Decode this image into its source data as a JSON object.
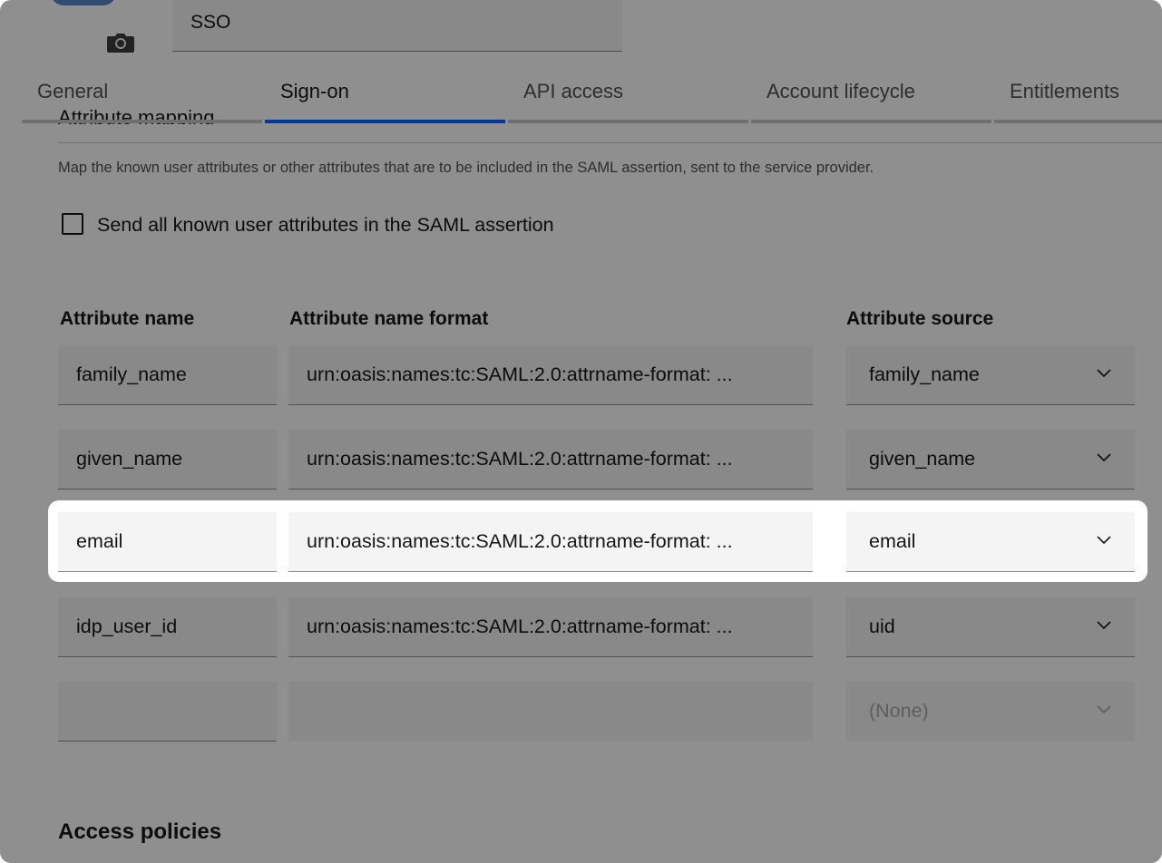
{
  "header": {
    "app_name_value": "SSO",
    "camera_icon": "camera-icon"
  },
  "tabs": [
    {
      "label": "General",
      "active": false
    },
    {
      "label": "Sign-on",
      "active": true
    },
    {
      "label": "API access",
      "active": false
    },
    {
      "label": "Account lifecycle",
      "active": false
    },
    {
      "label": "Entitlements",
      "active": false
    }
  ],
  "section": {
    "clipped_heading": "Attribute mapping",
    "description": "Map the known user attributes or other attributes that are to be included in the SAML assertion, sent to the service provider.",
    "checkbox_label": "Send all known user attributes in the SAML assertion",
    "checkbox_checked": false
  },
  "columns": {
    "name": "Attribute name",
    "format": "Attribute name format",
    "source": "Attribute source"
  },
  "rows": [
    {
      "name": "family_name",
      "format": "urn:oasis:names:tc:SAML:2.0:attrname-format: ...",
      "source": "family_name"
    },
    {
      "name": "given_name",
      "format": "urn:oasis:names:tc:SAML:2.0:attrname-format: ...",
      "source": "given_name"
    },
    {
      "name": "email",
      "format": "urn:oasis:names:tc:SAML:2.0:attrname-format: ...",
      "source": "email",
      "highlighted": true
    },
    {
      "name": "idp_user_id",
      "format": "urn:oasis:names:tc:SAML:2.0:attrname-format: ...",
      "source": "uid"
    },
    {
      "name": "",
      "format": "",
      "source": "(None)"
    }
  ],
  "footer": {
    "heading": "Access policies"
  },
  "colors": {
    "accent": "#0f62fe",
    "field_bg": "#f4f4f4",
    "overlay": "rgba(0,0,0,0.44)"
  }
}
